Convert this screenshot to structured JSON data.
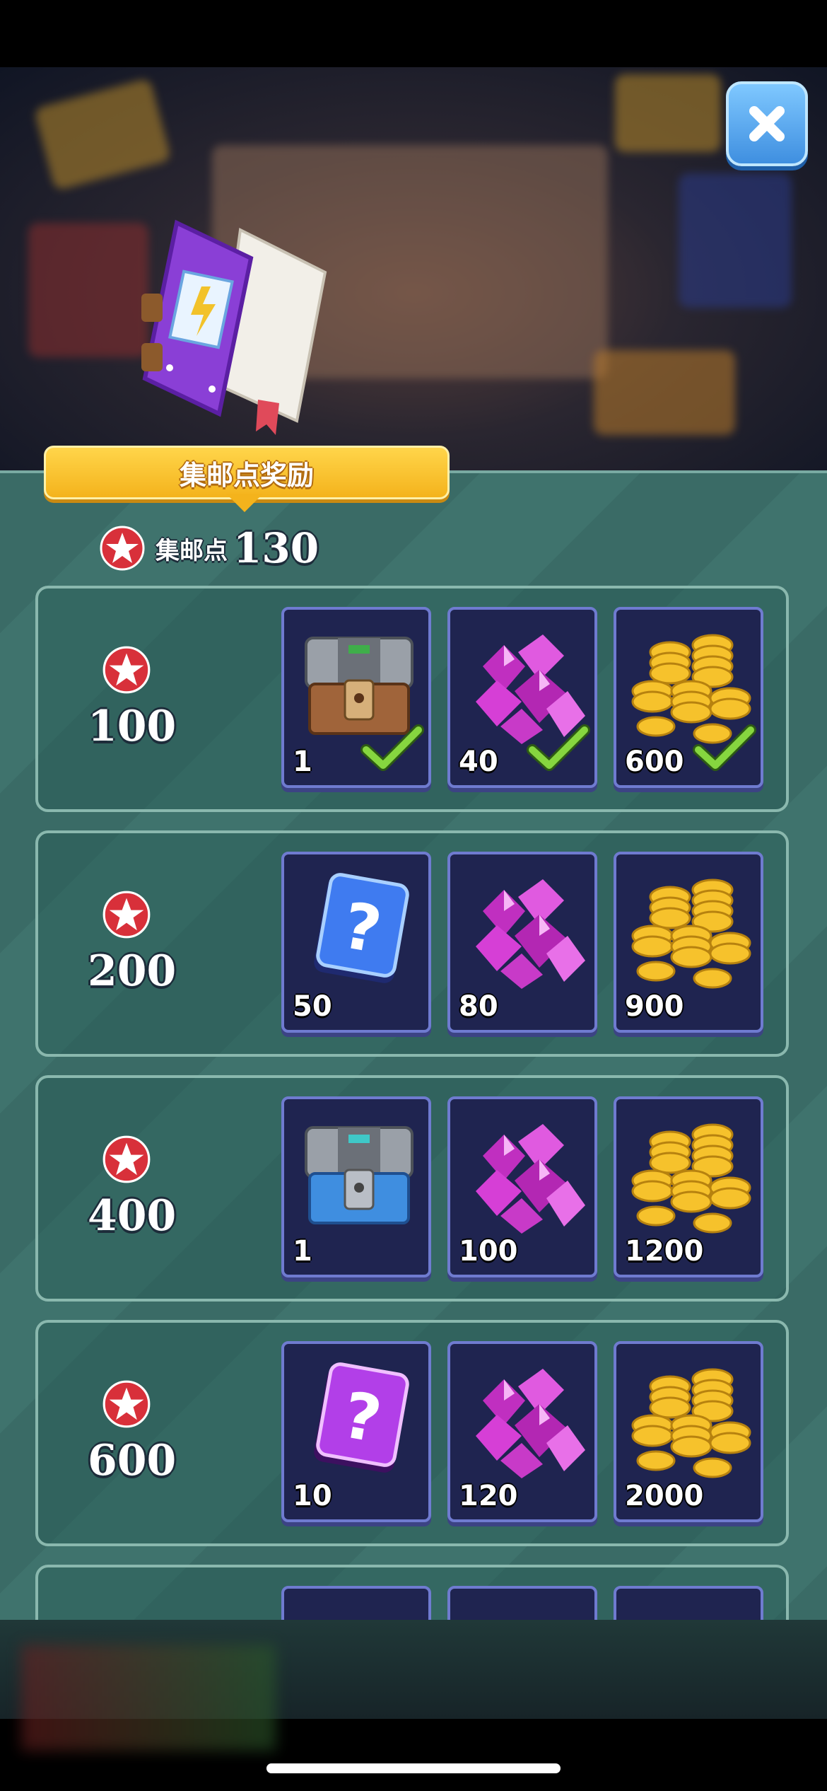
{
  "header": {
    "title": "集邮点奖励",
    "close_icon": "close-icon"
  },
  "points": {
    "label": "集邮点",
    "value": "130"
  },
  "colors": {
    "gold": "#f4b31c",
    "gem": "#d63fd6",
    "slot_bg": "#1f2450",
    "panel": "#3a6b66",
    "check": "#7dd23a"
  },
  "tiers": [
    {
      "threshold": "100",
      "rewards": [
        {
          "icon": "silver-chest-icon",
          "qty": "1",
          "claimed": true
        },
        {
          "icon": "gem-pile-icon",
          "qty": "40",
          "claimed": true
        },
        {
          "icon": "gold-coins-icon",
          "qty": "600",
          "claimed": true
        }
      ]
    },
    {
      "threshold": "200",
      "rewards": [
        {
          "icon": "blue-mystery-card-icon",
          "qty": "50",
          "claimed": false
        },
        {
          "icon": "gem-pile-icon",
          "qty": "80",
          "claimed": false
        },
        {
          "icon": "gold-coins-icon",
          "qty": "900",
          "claimed": false
        }
      ]
    },
    {
      "threshold": "400",
      "rewards": [
        {
          "icon": "blue-chest-icon",
          "qty": "1",
          "claimed": false
        },
        {
          "icon": "gem-pile-icon",
          "qty": "100",
          "claimed": false
        },
        {
          "icon": "gold-coins-icon",
          "qty": "1200",
          "claimed": false
        }
      ]
    },
    {
      "threshold": "600",
      "rewards": [
        {
          "icon": "purple-mystery-card-icon",
          "qty": "10",
          "claimed": false
        },
        {
          "icon": "gem-pile-icon",
          "qty": "120",
          "claimed": false
        },
        {
          "icon": "gold-coins-icon",
          "qty": "2000",
          "claimed": false
        }
      ]
    }
  ]
}
